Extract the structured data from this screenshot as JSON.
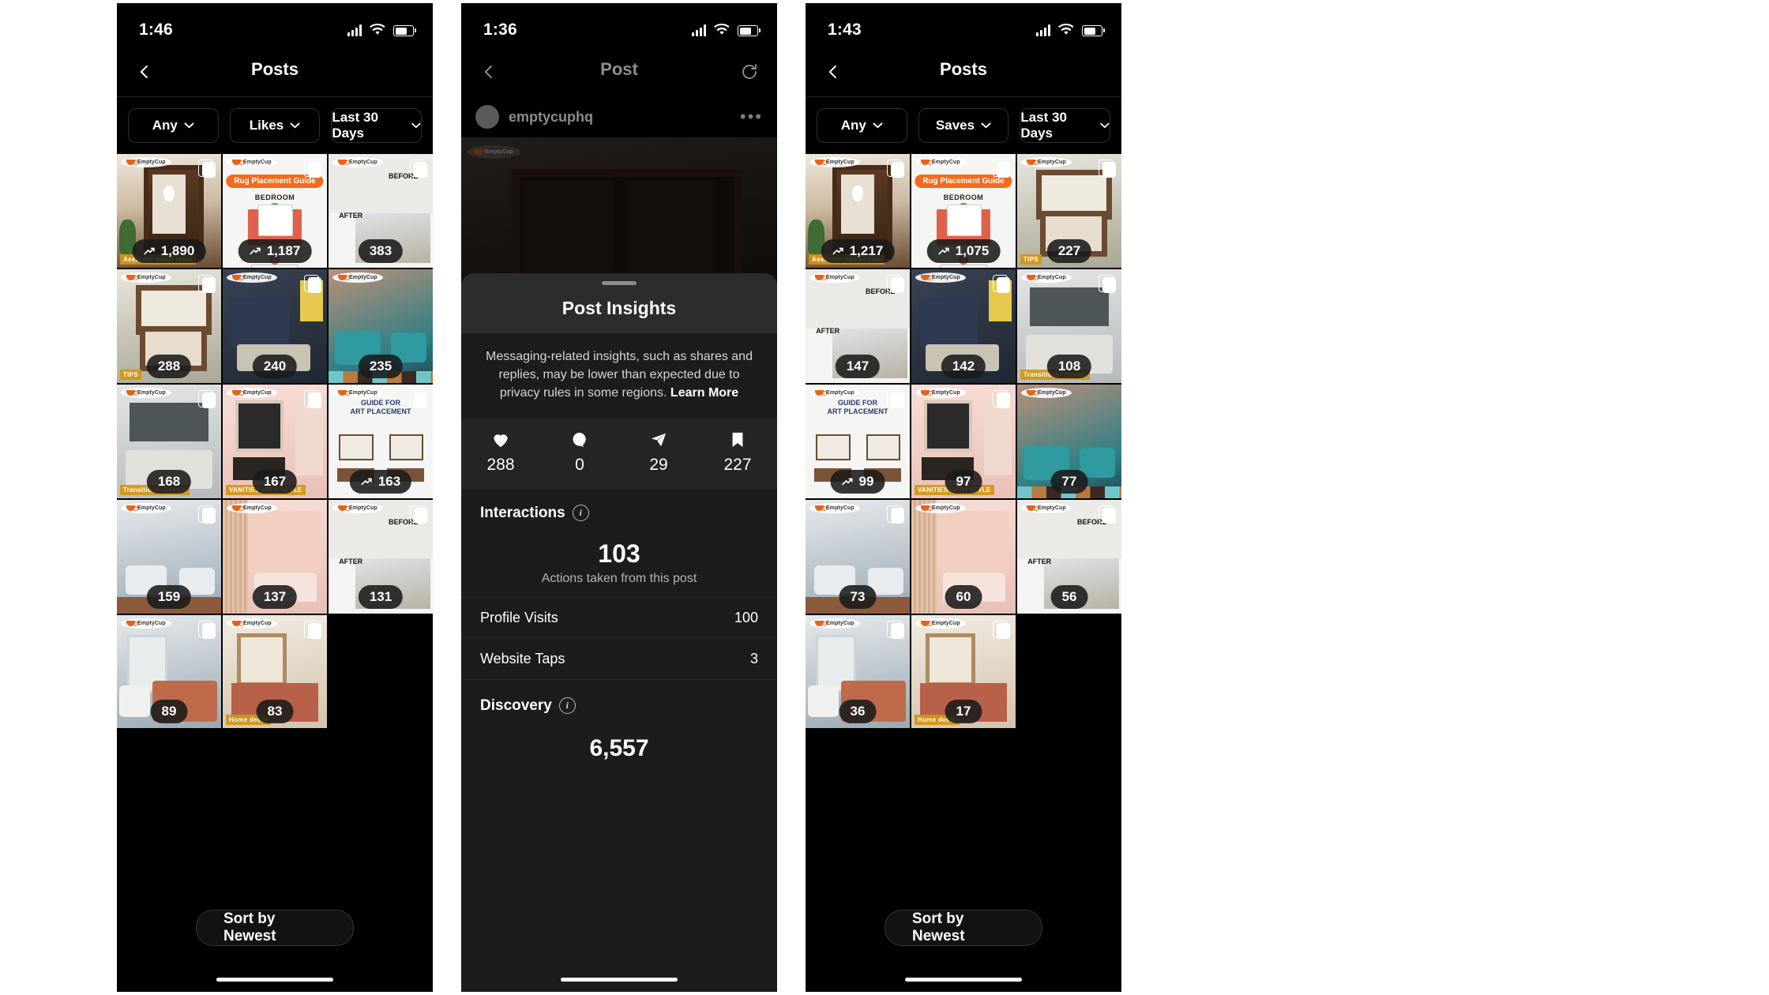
{
  "panels": [
    {
      "id": "posts-likes",
      "status": {
        "time": "1:46",
        "signal_icon": "signal-bars-icon",
        "wifi_icon": "wifi-icon",
        "battery_icon": "battery-icon"
      },
      "nav": {
        "back_icon": "chevron-left-icon",
        "title": "Posts"
      },
      "filters": [
        {
          "label": "Any",
          "icon": "chevron-down-icon"
        },
        {
          "label": "Likes",
          "icon": "chevron-down-icon"
        },
        {
          "label": "Last 30 Days",
          "icon": "chevron-down-icon"
        }
      ],
      "tiles": [
        {
          "value": "1,890",
          "trend": true,
          "art": "a-room",
          "kind": "pooja-room",
          "carousel": true,
          "watermark": true,
          "strip": "Aesthetic pooja room"
        },
        {
          "value": "1,187",
          "trend": true,
          "art": "a-guide",
          "kind": "rug-guide",
          "carousel": true,
          "watermark": true,
          "title": "Rug Placement Guide",
          "subtitle": "BEDROOM"
        },
        {
          "value": "383",
          "trend": false,
          "art": "a-white",
          "kind": "before-after",
          "carousel": true,
          "watermark": true
        },
        {
          "value": "288",
          "trend": false,
          "art": "a-sage",
          "kind": "shelf",
          "carousel": true,
          "watermark": true,
          "strip": "TIPS"
        },
        {
          "value": "240",
          "trend": false,
          "art": "a-dark",
          "kind": "blue-bedroom",
          "carousel": true,
          "watermark": true
        },
        {
          "value": "235",
          "trend": false,
          "art": "a-teal",
          "kind": "living-teal",
          "carousel": false,
          "watermark": true
        },
        {
          "value": "168",
          "trend": false,
          "art": "a-gray",
          "kind": "bedroom-gray",
          "carousel": true,
          "watermark": true,
          "strip": "Transitional Design"
        },
        {
          "value": "167",
          "trend": false,
          "art": "a-pink",
          "kind": "vanity",
          "carousel": true,
          "watermark": true,
          "strip": "VANITIES WITH STYLE"
        },
        {
          "value": "163",
          "trend": true,
          "art": "a-guide",
          "kind": "art-guide",
          "carousel": true,
          "watermark": true,
          "title": "GUIDE FOR ART PLACEMENT"
        },
        {
          "value": "159",
          "trend": false,
          "art": "a-blue",
          "kind": "living-white",
          "carousel": true,
          "watermark": true
        },
        {
          "value": "137",
          "trend": false,
          "art": "a-pink",
          "kind": "butterfly",
          "carousel": false,
          "watermark": true
        },
        {
          "value": "131",
          "trend": false,
          "art": "a-white",
          "kind": "before-after2",
          "carousel": true,
          "watermark": true
        },
        {
          "value": "89",
          "trend": false,
          "art": "a-blue",
          "kind": "fireplace",
          "carousel": true,
          "watermark": true
        },
        {
          "value": "83",
          "trend": false,
          "art": "a-beige",
          "kind": "rug-room",
          "carousel": true,
          "watermark": true,
          "strip": "Home decor"
        }
      ],
      "sort_button": "Sort by Newest"
    },
    {
      "id": "post-insights",
      "status": {
        "time": "1:36"
      },
      "nav": {
        "back_icon": "chevron-left-icon",
        "title": "Post",
        "right_icon": "refresh-icon"
      },
      "post": {
        "username": "emptycuphq",
        "more_icon": "more-options-icon",
        "avatar": "avatar"
      },
      "sheet": {
        "handle": "drag-handle",
        "title": "Post Insights",
        "notice": "Messaging-related insights, such as shares and replies, may be lower than expected due to privacy rules in some regions.",
        "notice_link": "Learn More",
        "metrics": [
          {
            "icon": "heart-icon",
            "value": "288"
          },
          {
            "icon": "comment-icon",
            "value": "0"
          },
          {
            "icon": "share-icon",
            "value": "29"
          },
          {
            "icon": "bookmark-icon",
            "value": "227"
          }
        ],
        "interactions": {
          "heading": "Interactions",
          "info_icon": "info-icon",
          "total": "103",
          "total_caption": "Actions taken from this post",
          "rows": [
            {
              "label": "Profile Visits",
              "value": "100"
            },
            {
              "label": "Website Taps",
              "value": "3"
            }
          ]
        },
        "discovery": {
          "heading": "Discovery",
          "info_icon": "info-icon",
          "total": "6,557"
        }
      }
    },
    {
      "id": "posts-saves",
      "status": {
        "time": "1:43"
      },
      "nav": {
        "back_icon": "chevron-left-icon",
        "title": "Posts"
      },
      "filters": [
        {
          "label": "Any",
          "icon": "chevron-down-icon"
        },
        {
          "label": "Saves",
          "icon": "chevron-down-icon"
        },
        {
          "label": "Last 30 Days",
          "icon": "chevron-down-icon"
        }
      ],
      "tiles": [
        {
          "value": "1,217",
          "trend": true,
          "art": "a-room",
          "kind": "pooja-room",
          "carousel": true,
          "watermark": true,
          "strip": "Aesthetic pooja room"
        },
        {
          "value": "1,075",
          "trend": true,
          "art": "a-guide",
          "kind": "rug-guide",
          "carousel": true,
          "watermark": true,
          "title": "Rug Placement Guide",
          "subtitle": "BEDROOM"
        },
        {
          "value": "227",
          "trend": false,
          "art": "a-sage",
          "kind": "shelf",
          "carousel": true,
          "watermark": true,
          "strip": "TIPS"
        },
        {
          "value": "147",
          "trend": false,
          "art": "a-white",
          "kind": "before-after",
          "carousel": true,
          "watermark": true
        },
        {
          "value": "142",
          "trend": false,
          "art": "a-dark",
          "kind": "blue-bedroom",
          "carousel": true,
          "watermark": true
        },
        {
          "value": "108",
          "trend": false,
          "art": "a-gray",
          "kind": "bedroom-gray",
          "carousel": true,
          "watermark": true,
          "strip": "Transitional Design"
        },
        {
          "value": "99",
          "trend": true,
          "art": "a-guide",
          "kind": "art-guide",
          "carousel": true,
          "watermark": true,
          "title": "GUIDE FOR ART PLACEMENT"
        },
        {
          "value": "97",
          "trend": false,
          "art": "a-pink",
          "kind": "vanity",
          "carousel": true,
          "watermark": true,
          "strip": "VANITIES WITH STYLE"
        },
        {
          "value": "77",
          "trend": false,
          "art": "a-teal",
          "kind": "living-teal",
          "carousel": false,
          "watermark": true
        },
        {
          "value": "73",
          "trend": false,
          "art": "a-blue",
          "kind": "living-white",
          "carousel": true,
          "watermark": true
        },
        {
          "value": "60",
          "trend": false,
          "art": "a-pink",
          "kind": "butterfly",
          "carousel": false,
          "watermark": true
        },
        {
          "value": "56",
          "trend": false,
          "art": "a-white",
          "kind": "before-after2",
          "carousel": true,
          "watermark": true
        },
        {
          "value": "36",
          "trend": false,
          "art": "a-blue",
          "kind": "fireplace",
          "carousel": true,
          "watermark": true
        },
        {
          "value": "17",
          "trend": false,
          "art": "a-beige",
          "kind": "rug-room",
          "carousel": true,
          "watermark": true,
          "strip": "Home decor"
        }
      ],
      "sort_button": "Sort by Newest"
    }
  ],
  "colors": {
    "accent_orange": "#f26c1f",
    "sheet_bg": "#1c1c1c",
    "sheet_head": "#2c2c2c",
    "badge_bg": "#1a1a1a"
  },
  "brand": {
    "watermark": "EmptyCup"
  }
}
